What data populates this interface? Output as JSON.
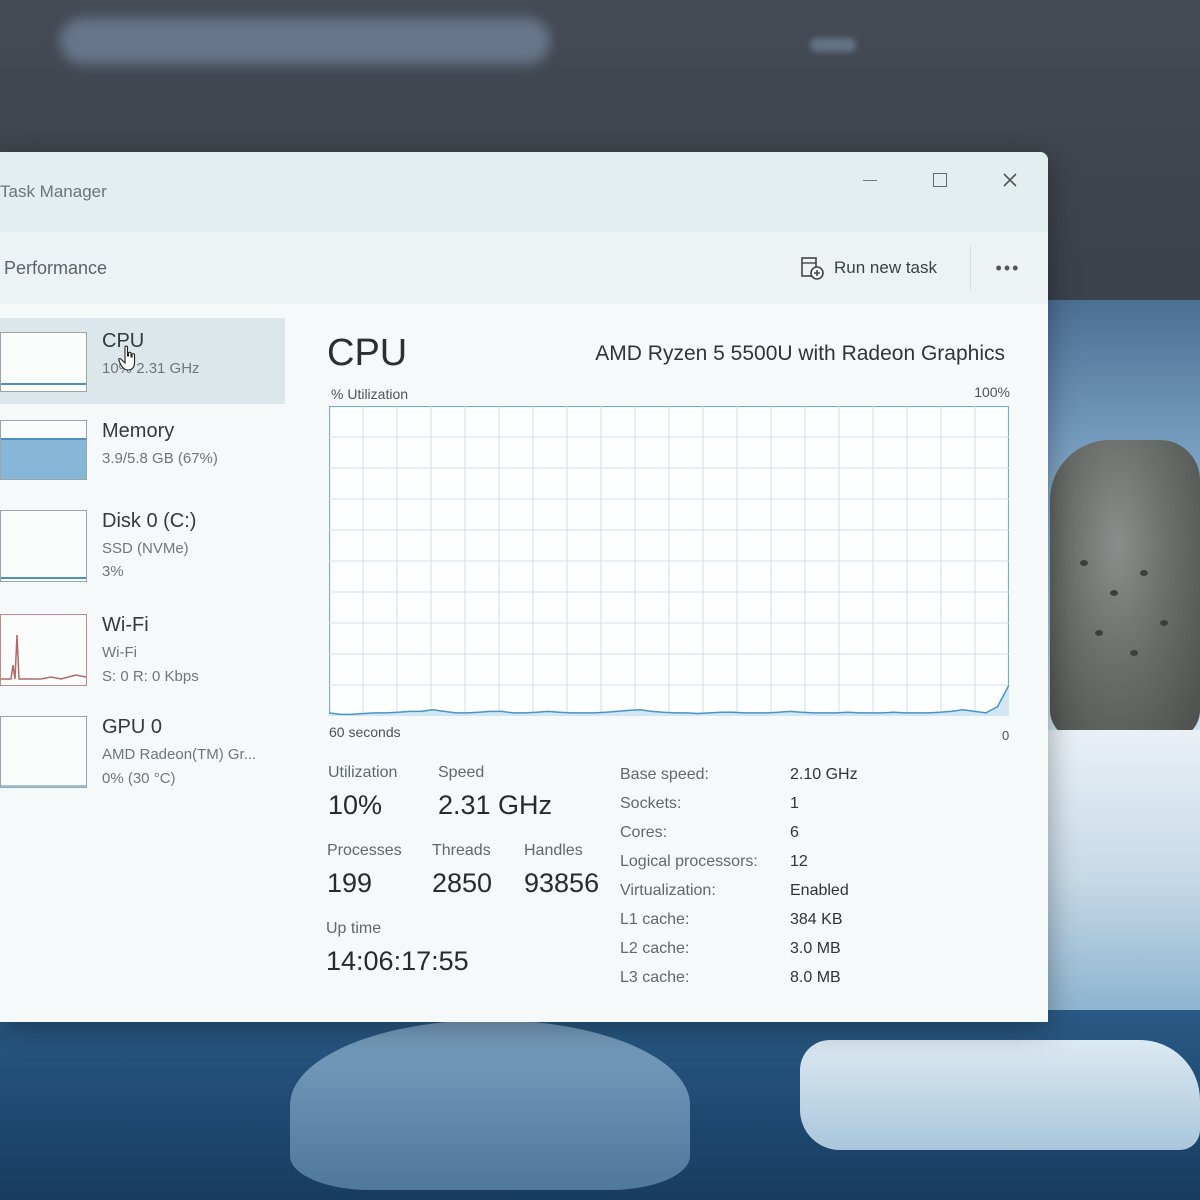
{
  "window": {
    "title": "Task Manager",
    "controls": {
      "minimize": "—",
      "maximize": "☐",
      "close": "✕"
    }
  },
  "toolbar": {
    "page_title": "Performance",
    "run_new_task": "Run new task",
    "more": "•••"
  },
  "sidebar": {
    "items": [
      {
        "title": "CPU",
        "subtitle": "10%  2.31 GHz",
        "fill": 0.1
      },
      {
        "title": "Memory",
        "subtitle": "3.9/5.8 GB (67%)",
        "fill": 0.67
      },
      {
        "title": "Disk 0 (C:)",
        "subtitle": "SSD (NVMe)",
        "subtitle2": "3%",
        "fill": 0.03
      },
      {
        "title": "Wi-Fi",
        "subtitle": "Wi-Fi",
        "subtitle2": "S: 0 R: 0 Kbps"
      },
      {
        "title": "GPU 0",
        "subtitle": "AMD Radeon(TM) Gr...",
        "subtitle2": "0%  (30 °C)",
        "fill": 0
      }
    ]
  },
  "cpu": {
    "title": "CPU",
    "model": "AMD Ryzen 5 5500U with Radeon Graphics",
    "graph": {
      "y_label": "% Utilization",
      "y_max_label": "100%",
      "x_left_label": "60 seconds",
      "x_right_label": "0",
      "accent_color": "#4a94c4",
      "series": [
        1.0,
        0.5,
        0.5,
        0.8,
        1.0,
        1.0,
        1.2,
        1.5,
        1.5,
        2.0,
        1.5,
        1.0,
        1.0,
        1.2,
        1.5,
        1.5,
        1.0,
        1.0,
        1.2,
        1.5,
        1.2,
        1.0,
        1.0,
        1.0,
        1.2,
        1.5,
        1.8,
        2.0,
        1.5,
        1.2,
        1.0,
        1.0,
        0.8,
        1.0,
        1.2,
        1.2,
        1.0,
        1.0,
        1.0,
        1.2,
        1.5,
        1.2,
        1.0,
        1.0,
        1.0,
        1.2,
        1.0,
        1.0,
        1.0,
        1.2,
        1.0,
        1.0,
        1.0,
        1.2,
        1.5,
        2.0,
        1.5,
        1.0,
        3.0,
        10.0
      ]
    },
    "stats": {
      "utilization_label": "Utilization",
      "utilization_value": "10%",
      "speed_label": "Speed",
      "speed_value": "2.31 GHz",
      "processes_label": "Processes",
      "processes_value": "199",
      "threads_label": "Threads",
      "threads_value": "2850",
      "handles_label": "Handles",
      "handles_value": "93856",
      "uptime_label": "Up time",
      "uptime_value": "14:06:17:55"
    },
    "specs": [
      {
        "key": "Base speed:",
        "value": "2.10 GHz"
      },
      {
        "key": "Sockets:",
        "value": "1"
      },
      {
        "key": "Cores:",
        "value": "6"
      },
      {
        "key": "Logical processors:",
        "value": "12"
      },
      {
        "key": "Virtualization:",
        "value": "Enabled"
      },
      {
        "key": "L1 cache:",
        "value": "384 KB"
      },
      {
        "key": "L2 cache:",
        "value": "3.0 MB"
      },
      {
        "key": "L3 cache:",
        "value": "8.0 MB"
      }
    ]
  }
}
